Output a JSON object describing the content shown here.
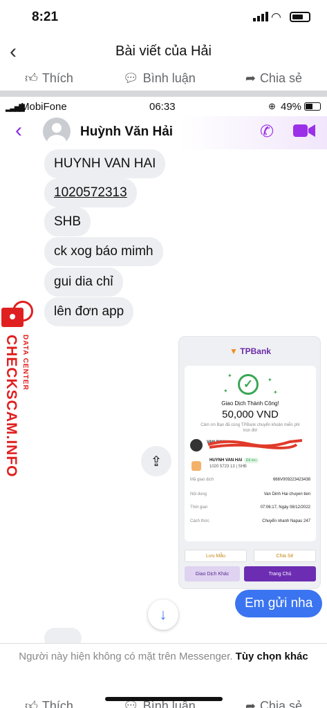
{
  "status": {
    "time": "8:21"
  },
  "header": {
    "title": "Bài viết của Hải"
  },
  "actions": {
    "like": "Thích",
    "comment": "Bình luận",
    "share": "Chia sẻ"
  },
  "chat": {
    "carrier": "MobiFone",
    "time": "06:33",
    "battery": "49%",
    "contact_name": "Huỳnh Văn Hải",
    "messages": [
      "HUYNH VAN HAI",
      "1020572313",
      "SHB",
      "ck xog báo mimh",
      "gui dia chỉ",
      "lên đơn app"
    ],
    "sent_message": "Em gửi nha",
    "accent": "#9b30e8"
  },
  "receipt": {
    "bank": "TPBank",
    "title": "Giao Dịch Thành Công!",
    "amount": "50,000 VND",
    "note": "Cảm ơn Bạn đã cùng TPBank chuyển khoản miễn phí trọn đời",
    "from_name": "VAN DINH",
    "to_name": "HUYNH VAN HAI",
    "to_badge": "Đã lưu",
    "to_account": "1020 5723 13 | SHB",
    "rows": [
      {
        "k": "Mã giao dịch",
        "v": "666V009223423438"
      },
      {
        "k": "Nội dung",
        "v": "Van Dinh Hai chuyen tien"
      },
      {
        "k": "Thời gian",
        "v": "07:06:17, Ngày 08/12/2022"
      },
      {
        "k": "Cách thức",
        "v": "Chuyển nhanh Napas 247"
      }
    ],
    "save_btn": "Lưu Mẫu",
    "share_btn": "Chia Sẻ",
    "other_btn": "Giao Dịch Khác",
    "home_btn": "Trang Chủ"
  },
  "watermark": {
    "main": "CHECKSCAM.INFO",
    "sub": "DATA CENTER"
  },
  "notice": {
    "text": "Người này hiện không có mặt trên Messenger.",
    "option": "Tùy chọn khác"
  }
}
